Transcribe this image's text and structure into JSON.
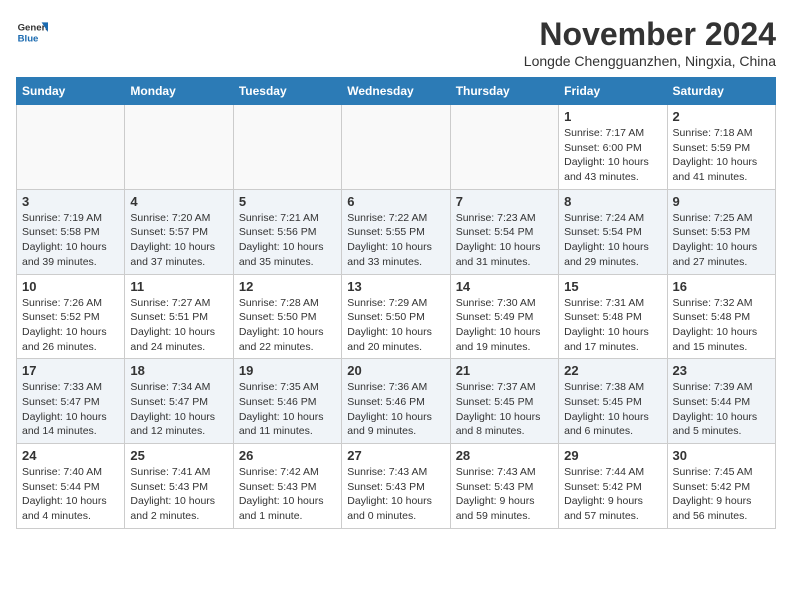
{
  "header": {
    "logo_general": "General",
    "logo_blue": "Blue",
    "month_title": "November 2024",
    "location": "Longde Chengguanzhen, Ningxia, China"
  },
  "calendar": {
    "weekdays": [
      "Sunday",
      "Monday",
      "Tuesday",
      "Wednesday",
      "Thursday",
      "Friday",
      "Saturday"
    ],
    "weeks": [
      [
        {
          "day": "",
          "info": ""
        },
        {
          "day": "",
          "info": ""
        },
        {
          "day": "",
          "info": ""
        },
        {
          "day": "",
          "info": ""
        },
        {
          "day": "",
          "info": ""
        },
        {
          "day": "1",
          "info": "Sunrise: 7:17 AM\nSunset: 6:00 PM\nDaylight: 10 hours and 43 minutes."
        },
        {
          "day": "2",
          "info": "Sunrise: 7:18 AM\nSunset: 5:59 PM\nDaylight: 10 hours and 41 minutes."
        }
      ],
      [
        {
          "day": "3",
          "info": "Sunrise: 7:19 AM\nSunset: 5:58 PM\nDaylight: 10 hours and 39 minutes."
        },
        {
          "day": "4",
          "info": "Sunrise: 7:20 AM\nSunset: 5:57 PM\nDaylight: 10 hours and 37 minutes."
        },
        {
          "day": "5",
          "info": "Sunrise: 7:21 AM\nSunset: 5:56 PM\nDaylight: 10 hours and 35 minutes."
        },
        {
          "day": "6",
          "info": "Sunrise: 7:22 AM\nSunset: 5:55 PM\nDaylight: 10 hours and 33 minutes."
        },
        {
          "day": "7",
          "info": "Sunrise: 7:23 AM\nSunset: 5:54 PM\nDaylight: 10 hours and 31 minutes."
        },
        {
          "day": "8",
          "info": "Sunrise: 7:24 AM\nSunset: 5:54 PM\nDaylight: 10 hours and 29 minutes."
        },
        {
          "day": "9",
          "info": "Sunrise: 7:25 AM\nSunset: 5:53 PM\nDaylight: 10 hours and 27 minutes."
        }
      ],
      [
        {
          "day": "10",
          "info": "Sunrise: 7:26 AM\nSunset: 5:52 PM\nDaylight: 10 hours and 26 minutes."
        },
        {
          "day": "11",
          "info": "Sunrise: 7:27 AM\nSunset: 5:51 PM\nDaylight: 10 hours and 24 minutes."
        },
        {
          "day": "12",
          "info": "Sunrise: 7:28 AM\nSunset: 5:50 PM\nDaylight: 10 hours and 22 minutes."
        },
        {
          "day": "13",
          "info": "Sunrise: 7:29 AM\nSunset: 5:50 PM\nDaylight: 10 hours and 20 minutes."
        },
        {
          "day": "14",
          "info": "Sunrise: 7:30 AM\nSunset: 5:49 PM\nDaylight: 10 hours and 19 minutes."
        },
        {
          "day": "15",
          "info": "Sunrise: 7:31 AM\nSunset: 5:48 PM\nDaylight: 10 hours and 17 minutes."
        },
        {
          "day": "16",
          "info": "Sunrise: 7:32 AM\nSunset: 5:48 PM\nDaylight: 10 hours and 15 minutes."
        }
      ],
      [
        {
          "day": "17",
          "info": "Sunrise: 7:33 AM\nSunset: 5:47 PM\nDaylight: 10 hours and 14 minutes."
        },
        {
          "day": "18",
          "info": "Sunrise: 7:34 AM\nSunset: 5:47 PM\nDaylight: 10 hours and 12 minutes."
        },
        {
          "day": "19",
          "info": "Sunrise: 7:35 AM\nSunset: 5:46 PM\nDaylight: 10 hours and 11 minutes."
        },
        {
          "day": "20",
          "info": "Sunrise: 7:36 AM\nSunset: 5:46 PM\nDaylight: 10 hours and 9 minutes."
        },
        {
          "day": "21",
          "info": "Sunrise: 7:37 AM\nSunset: 5:45 PM\nDaylight: 10 hours and 8 minutes."
        },
        {
          "day": "22",
          "info": "Sunrise: 7:38 AM\nSunset: 5:45 PM\nDaylight: 10 hours and 6 minutes."
        },
        {
          "day": "23",
          "info": "Sunrise: 7:39 AM\nSunset: 5:44 PM\nDaylight: 10 hours and 5 minutes."
        }
      ],
      [
        {
          "day": "24",
          "info": "Sunrise: 7:40 AM\nSunset: 5:44 PM\nDaylight: 10 hours and 4 minutes."
        },
        {
          "day": "25",
          "info": "Sunrise: 7:41 AM\nSunset: 5:43 PM\nDaylight: 10 hours and 2 minutes."
        },
        {
          "day": "26",
          "info": "Sunrise: 7:42 AM\nSunset: 5:43 PM\nDaylight: 10 hours and 1 minute."
        },
        {
          "day": "27",
          "info": "Sunrise: 7:43 AM\nSunset: 5:43 PM\nDaylight: 10 hours and 0 minutes."
        },
        {
          "day": "28",
          "info": "Sunrise: 7:43 AM\nSunset: 5:43 PM\nDaylight: 9 hours and 59 minutes."
        },
        {
          "day": "29",
          "info": "Sunrise: 7:44 AM\nSunset: 5:42 PM\nDaylight: 9 hours and 57 minutes."
        },
        {
          "day": "30",
          "info": "Sunrise: 7:45 AM\nSunset: 5:42 PM\nDaylight: 9 hours and 56 minutes."
        }
      ]
    ]
  }
}
